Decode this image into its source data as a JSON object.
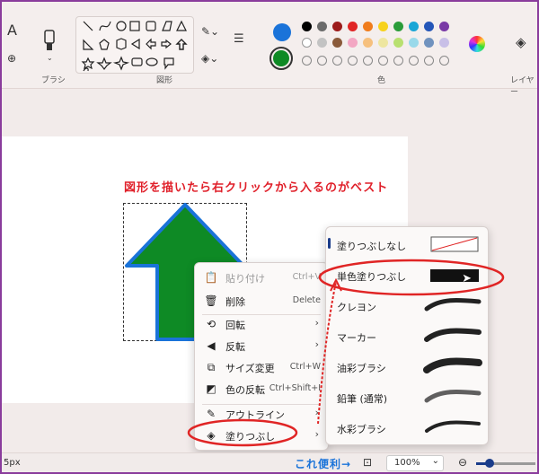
{
  "ribbon": {
    "brush_label": "ブラシ",
    "shapes_label": "図形",
    "colors_label": "色",
    "layers_label": "レイヤー",
    "text_tool": "A"
  },
  "colors": {
    "primary": "#1a73d9",
    "secondary": "#0e8a25",
    "palette_row1": [
      "#000000",
      "#6b6b6b",
      "#9c1b1b",
      "#e02525",
      "#f07c1c",
      "#f7d21c",
      "#2a9c3a",
      "#1aa6d6",
      "#2456b8",
      "#7a3aa6"
    ],
    "palette_row2": [
      "#ffffff",
      "#c3c3c3",
      "#8a5a3a",
      "#f3a7c3",
      "#f6c07e",
      "#eee6a0",
      "#b8e070",
      "#99d9ea",
      "#7092be",
      "#c8bfe7"
    ]
  },
  "annotation": {
    "title": "図形を描いたら右クリックから入るのがベスト",
    "handy": "これ便利→"
  },
  "context_menu": {
    "items": [
      {
        "label": "貼り付け",
        "shortcut": "Ctrl+V",
        "icon": "paste-icon"
      },
      {
        "label": "削除",
        "shortcut": "Delete",
        "icon": "trash-icon"
      },
      {
        "label": "回転",
        "shortcut": "",
        "icon": "rotate-icon"
      },
      {
        "label": "反転",
        "shortcut": "",
        "icon": "flip-icon"
      },
      {
        "label": "サイズ変更",
        "shortcut": "Ctrl+W",
        "icon": "resize-icon"
      },
      {
        "label": "色の反転",
        "shortcut": "Ctrl+Shift+I",
        "icon": "invert-icon"
      },
      {
        "label": "アウトライン",
        "shortcut": "",
        "icon": "outline-icon"
      },
      {
        "label": "塗りつぶし",
        "shortcut": "",
        "icon": "fill-icon"
      }
    ]
  },
  "fill_submenu": {
    "items": [
      {
        "label": "塗りつぶしなし"
      },
      {
        "label": "単色塗りつぶし"
      },
      {
        "label": "クレヨン"
      },
      {
        "label": "マーカー"
      },
      {
        "label": "油彩ブラシ"
      },
      {
        "label": "鉛筆 (通常)"
      },
      {
        "label": "水彩ブラシ"
      }
    ]
  },
  "status": {
    "size_text": "5px",
    "zoom": "100%"
  }
}
